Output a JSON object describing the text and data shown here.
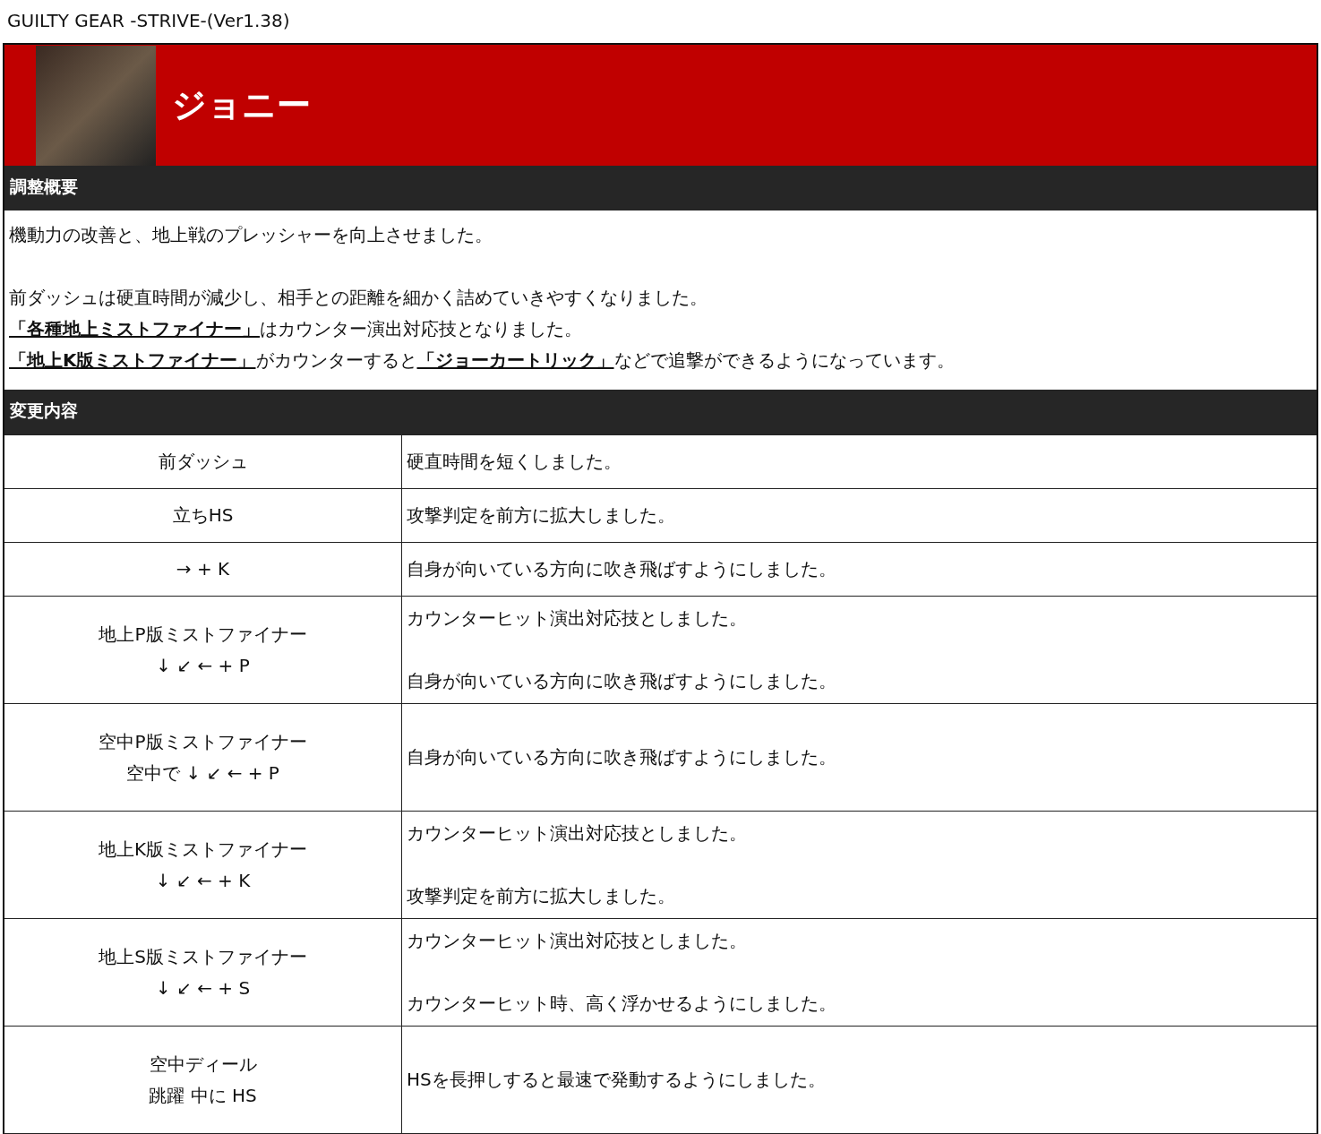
{
  "page_title": "GUILTY GEAR -STRIVE-(Ver1.38)",
  "character": {
    "name": "ジョニー"
  },
  "summary": {
    "heading": "調整概要",
    "blocks": [
      [
        [
          {
            "kind": "text",
            "text": "機動力の改善と、地上戦のプレッシャーを向上させました。"
          }
        ]
      ],
      [
        [
          {
            "kind": "text",
            "text": "前ダッシュは硬直時間が減少し、相手との距離を細かく詰めていきやすくなりました。"
          }
        ],
        [
          {
            "kind": "link",
            "text": "「各種地上ミストファイナー」"
          },
          {
            "kind": "text",
            "text": "はカウンター演出対応技となりました。"
          }
        ],
        [
          {
            "kind": "link",
            "text": "「地上K版ミストファイナー」"
          },
          {
            "kind": "text",
            "text": "がカウンターすると"
          },
          {
            "kind": "link",
            "text": "「ジョーカートリック」"
          },
          {
            "kind": "text",
            "text": "などで追撃ができるようになっています。"
          }
        ]
      ]
    ]
  },
  "changes": {
    "heading": "変更内容",
    "rows": [
      {
        "move": [
          "前ダッシュ"
        ],
        "details": [
          "硬直時間を短くしました。"
        ]
      },
      {
        "move": [
          "立ちHS"
        ],
        "details": [
          "攻撃判定を前方に拡大しました。"
        ]
      },
      {
        "move": [
          "→ + K"
        ],
        "details": [
          "自身が向いている方向に吹き飛ばすようにしました。"
        ]
      },
      {
        "move": [
          "地上P版ミストファイナー",
          "↓ ↙ ← + P"
        ],
        "details": [
          "カウンターヒット演出対応技としました。",
          "自身が向いている方向に吹き飛ばすようにしました。"
        ]
      },
      {
        "move": [
          "空中P版ミストファイナー",
          "空中で ↓ ↙ ← + P"
        ],
        "details": [
          "自身が向いている方向に吹き飛ばすようにしました。"
        ]
      },
      {
        "move": [
          "地上K版ミストファイナー",
          "↓ ↙ ← + K"
        ],
        "details": [
          "カウンターヒット演出対応技としました。",
          "攻撃判定を前方に拡大しました。"
        ]
      },
      {
        "move": [
          "地上S版ミストファイナー",
          "↓ ↙ ← + S"
        ],
        "details": [
          "カウンターヒット演出対応技としました。",
          "カウンターヒット時、高く浮かせるようにしました。"
        ]
      },
      {
        "move": [
          "空中ディール",
          "跳躍 中に HS"
        ],
        "details": [
          "HSを長押しすると最速で発動するようにしました。"
        ]
      }
    ]
  }
}
